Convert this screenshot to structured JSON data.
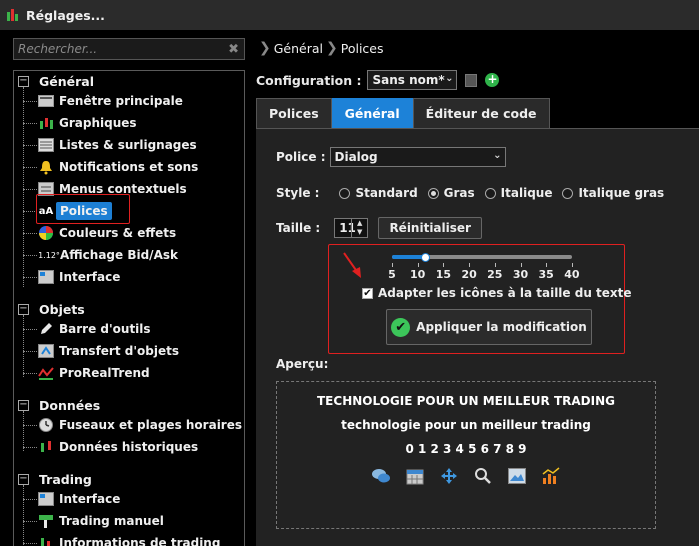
{
  "window": {
    "title": "Réglages..."
  },
  "search": {
    "placeholder": "Rechercher..."
  },
  "tree": {
    "groups": [
      {
        "label": "Général",
        "items": [
          "Fenêtre principale",
          "Graphiques",
          "Listes & surlignages",
          "Notifications et sons",
          "Menus contextuels",
          "Polices",
          "Couleurs & effets",
          "Affichage Bid/Ask",
          "Interface"
        ]
      },
      {
        "label": "Objets",
        "items": [
          "Barre d'outils",
          "Transfert d'objets",
          "ProRealTrend"
        ]
      },
      {
        "label": "Données",
        "items": [
          "Fuseaux et plages horaires",
          "Données historiques"
        ]
      },
      {
        "label": "Trading",
        "items": [
          "Interface",
          "Trading manuel",
          "Informations de trading"
        ]
      }
    ],
    "bidask_icon_text": "1.12°"
  },
  "breadcrumb": {
    "first": "Général",
    "second": "Polices"
  },
  "config": {
    "label": "Configuration :",
    "value": "Sans nom*"
  },
  "tabs": [
    "Polices",
    "Général",
    "Éditeur de code"
  ],
  "font": {
    "label": "Police :",
    "value": "Dialog"
  },
  "style": {
    "label": "Style :",
    "options": [
      "Standard",
      "Gras",
      "Italique",
      "Italique gras"
    ],
    "selected": "Gras"
  },
  "size": {
    "label": "Taille :",
    "value": "11",
    "reset_label": "Réinitialiser"
  },
  "slider": {
    "ticks": [
      "5",
      "10",
      "15",
      "20",
      "25",
      "30",
      "35",
      "40"
    ],
    "value": 12
  },
  "adapt_checkbox": {
    "label": "Adapter les icônes à la taille du texte",
    "checked": true
  },
  "apply_button": {
    "label": "Appliquer la modification"
  },
  "preview": {
    "label": "Aperçu:",
    "line_upper": "TECHNOLOGIE POUR UN MEILLEUR TRADING",
    "line_lower": "technologie pour un meilleur trading",
    "digits": "0 1 2 3 4 5 6 7 8 9"
  },
  "colors": {
    "accent": "#1d82d8",
    "highlight": "#e02020",
    "ok": "#3cc65a"
  }
}
